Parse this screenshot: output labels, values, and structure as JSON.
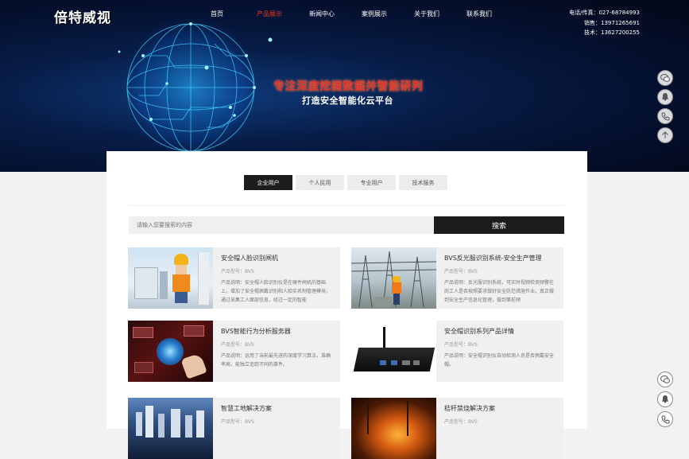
{
  "logo": "倍特威视",
  "nav": [
    "首页",
    "产品展示",
    "新闻中心",
    "案例展示",
    "关于我们",
    "联系我们"
  ],
  "nav_active": 1,
  "contact": [
    "电话/传真：027-68784993",
    "销售：13971265691",
    "技术：13627200255"
  ],
  "banner": {
    "slogan1": "专注深度挖掘数据并智能研判",
    "slogan2": "打造安全智能化云平台"
  },
  "tabs": [
    "企业用户",
    "个人民用",
    "专业用户",
    "技术服务"
  ],
  "tab_active": 0,
  "search": {
    "placeholder": "请输入您要搜索的内容",
    "button": "搜索"
  },
  "products": [
    {
      "title": "安全帽人脸识别闸机",
      "model": "产品型号：BVS",
      "desc": "产品说明：安全帽人脸识别仪是在硬件闸机的基础上，增加了安全帽佩戴识别和人脸实名制管理模块，通过采集工人面部信息，经过一定的智能"
    },
    {
      "title": "BVS反光服识别系统-安全生产管理",
      "model": "产品型号：BVS",
      "desc": "产品说明：反光服识别系统，可实时视频检测预警在岗工人是否按照要求做好安全防范措施作业。真正做到安全生产信息化管理，做到事前预"
    },
    {
      "title": "BVS智能行为分析服务器",
      "model": "产品型号：BVS",
      "desc": "产品说明：运用了当前最先进的深度学习算法，准确率高，能独立追踪不同的事件。"
    },
    {
      "title": "安全帽识别系列产品详情",
      "model": "产品型号：BVS",
      "desc": "产品说明：安全帽识别仪自动检测人员是否佩戴安全帽。"
    },
    {
      "title": "智慧工地解决方案",
      "model": "产品型号：BVS",
      "desc": ""
    },
    {
      "title": "秸秆禁烧解决方案",
      "model": "产品型号：BVS",
      "desc": ""
    }
  ],
  "colors": {
    "accent": "#e03c2c",
    "dark": "#1c1c1c",
    "banner": "#061639"
  },
  "side_icons": [
    "wechat-icon",
    "qq-icon",
    "phone-icon",
    "arrow-up-icon"
  ]
}
